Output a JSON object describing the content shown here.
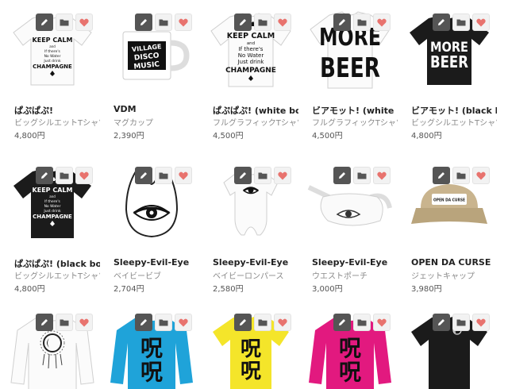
{
  "icons": {
    "edit": "pencil-icon",
    "folder": "folder-icon",
    "favorite": "heart-icon"
  },
  "colors": {
    "heart": "#e8736e",
    "edit_bg": "#555555"
  },
  "products": [
    {
      "name": "ぱぷぱぷ!",
      "type": "ビッグシルエットTシャツ",
      "price": "4,800円",
      "art": "tee-white-keepcalm"
    },
    {
      "name": "VDM",
      "type": "マグカップ",
      "price": "2,390円",
      "art": "mug"
    },
    {
      "name": "ぱぷぱぷ! (white bo…",
      "type": "フルグラフィックTシャツ",
      "price": "4,500円",
      "art": "tee-white-keepcalm-full"
    },
    {
      "name": "ビアモット! (white b…",
      "type": "フルグラフィックTシャツ",
      "price": "4,500円",
      "art": "tee-morebeer-full"
    },
    {
      "name": "ビアモット! (black b…",
      "type": "ビッグシルエットTシャツ",
      "price": "4,800円",
      "art": "tee-black-morebeer"
    },
    {
      "name": "ぱぷぱぷ! (black bod…",
      "type": "ビッグシルエットTシャツ",
      "price": "4,800円",
      "art": "tee-black-keepcalm"
    },
    {
      "name": "Sleepy-Evil-Eye",
      "type": "ベイビービブ",
      "price": "2,704円",
      "art": "bib"
    },
    {
      "name": "Sleepy-Evil-Eye",
      "type": "ベイビーロンパース",
      "price": "2,580円",
      "art": "romper"
    },
    {
      "name": "Sleepy-Evil-Eye",
      "type": "ウエストポーチ",
      "price": "3,000円",
      "art": "pouch"
    },
    {
      "name": "OPEN DA CURSE",
      "type": "ジェットキャップ",
      "price": "3,980円",
      "art": "cap"
    },
    {
      "name": "",
      "type": "",
      "price": "",
      "art": "sweat-white"
    },
    {
      "name": "",
      "type": "",
      "price": "",
      "art": "sweat-blue"
    },
    {
      "name": "",
      "type": "",
      "price": "",
      "art": "tee-yellow"
    },
    {
      "name": "",
      "type": "",
      "price": "",
      "art": "sweat-pink"
    },
    {
      "name": "",
      "type": "",
      "price": "",
      "art": "tee-black-small"
    }
  ],
  "print_text": {
    "keepcalm": [
      "KEEP CALM",
      "and",
      "If there's",
      "No Water",
      "Just drink",
      "CHAMPAGNE"
    ],
    "morebeer": [
      "MORE",
      "BEER"
    ],
    "mug": [
      "VILLAGE",
      "DISCO",
      "MUSIC"
    ],
    "cap": "OPEN DA CURSE",
    "kanji": [
      "呪",
      "呪"
    ]
  }
}
